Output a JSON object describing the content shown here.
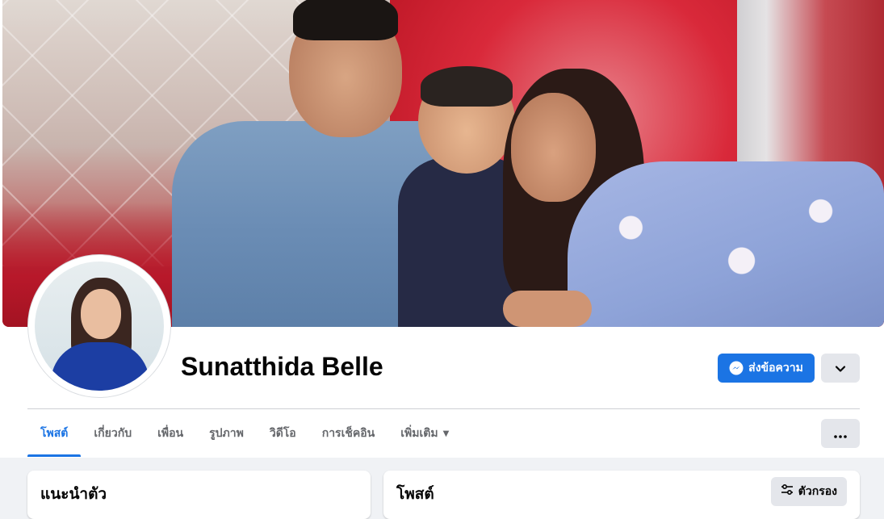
{
  "profile": {
    "name": "Sunatthida Belle"
  },
  "actions": {
    "message_label": "ส่งข้อความ"
  },
  "tabs": [
    {
      "label": "โพสต์",
      "active": true
    },
    {
      "label": "เกี่ยวกับ",
      "active": false
    },
    {
      "label": "เพื่อน",
      "active": false
    },
    {
      "label": "รูปภาพ",
      "active": false
    },
    {
      "label": "วิดีโอ",
      "active": false
    },
    {
      "label": "การเช็คอิน",
      "active": false
    },
    {
      "label": "เพิ่มเติม",
      "active": false
    }
  ],
  "intro": {
    "title": "แนะนำตัว"
  },
  "posts": {
    "title": "โพสต์",
    "filter_label": "ตัวกรอง"
  },
  "colors": {
    "accent": "#1b74e4",
    "secondary_button": "#e4e6eb",
    "muted_text": "#65676b",
    "background": "#f0f2f5"
  },
  "icons": {
    "message_button": "messenger-icon",
    "dropdown": "chevron-down-icon",
    "more_tab_caret": "caret-down-icon",
    "overflow": "more-horizontal-icon",
    "filter": "filter-sliders-icon"
  }
}
